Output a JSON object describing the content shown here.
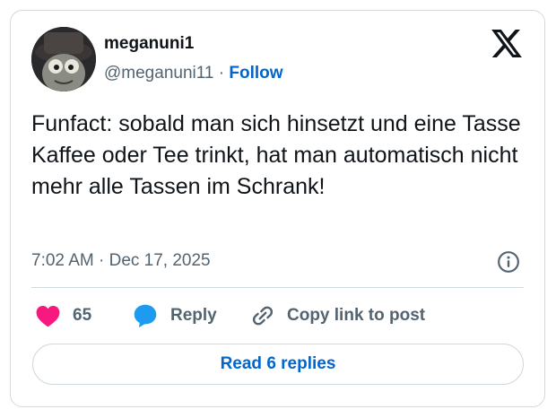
{
  "author": {
    "display_name": "meganuni1",
    "handle": "@meganuni11",
    "separator": "·",
    "follow_label": "Follow"
  },
  "tweet": {
    "text": "Funfact: sobald man sich hinsetzt und eine Tasse Kaffee oder Tee trinkt, hat man automatisch nicht mehr alle Tassen im Schrank!",
    "timestamp": "7:02 AM · Dec 17, 2025"
  },
  "actions": {
    "like_count": "65",
    "reply_label": "Reply",
    "copy_label": "Copy link to post"
  },
  "replies_button": {
    "label": "Read 6 replies"
  },
  "icons": {
    "platform": "x-logo-icon",
    "info": "info-icon",
    "like": "heart-icon",
    "reply": "speech-bubble-icon",
    "copy": "link-icon"
  },
  "colors": {
    "accent": "#0066cc",
    "like": "#f91880",
    "reply": "#1d9bf0",
    "muted_text": "#536471",
    "border": "#cfd9de"
  }
}
